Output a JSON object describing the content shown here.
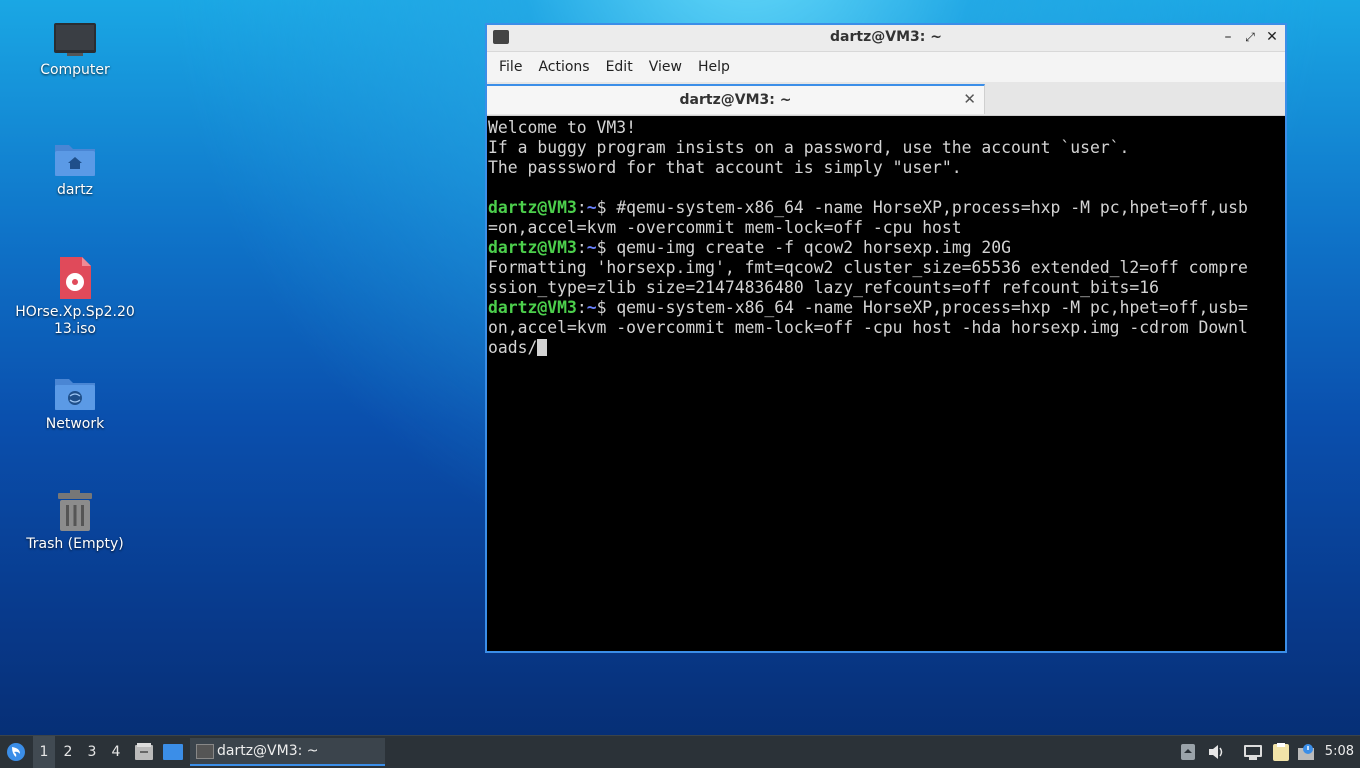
{
  "desktop": {
    "icons": [
      {
        "label": "Computer"
      },
      {
        "label": "dartz"
      },
      {
        "label": "HOrse.Xp.Sp2.2013.iso"
      },
      {
        "label": "Network"
      },
      {
        "label": "Trash (Empty)"
      }
    ]
  },
  "window": {
    "title": "dartz@VM3: ~",
    "menu": [
      "File",
      "Actions",
      "Edit",
      "View",
      "Help"
    ],
    "tab_label": "dartz@VM3: ~",
    "tab_close": "✕"
  },
  "terminal": {
    "welcome": [
      "Welcome to VM3!",
      "If a buggy program insists on a password, use the account `user`.",
      "The passsword for that account is simply \"user\"."
    ],
    "prompt_user": "dartz@VM3",
    "prompt_path": "~",
    "cmd1": "#qemu-system-x86_64 -name HorseXP,process=hxp -M pc,hpet=off,usb\n=on,accel=kvm -overcommit mem-lock=off -cpu host",
    "cmd2": "qemu-img create -f qcow2 horsexp.img 20G",
    "out2": "Formatting 'horsexp.img', fmt=qcow2 cluster_size=65536 extended_l2=off compre\nssion_type=zlib size=21474836480 lazy_refcounts=off refcount_bits=16",
    "cmd3": "qemu-system-x86_64 -name HorseXP,process=hxp -M pc,hpet=off,usb=\non,accel=kvm -overcommit mem-lock=off -cpu host -hda horsexp.img -cdrom Downl\noads/"
  },
  "taskbar": {
    "workspaces": [
      "1",
      "2",
      "3",
      "4"
    ],
    "task_label": "dartz@VM3: ~",
    "clock": "5:08"
  },
  "colors": {
    "accent": "#3b8ee8",
    "prompt_user": "#4ccf4c",
    "prompt_path": "#6b83ff"
  }
}
